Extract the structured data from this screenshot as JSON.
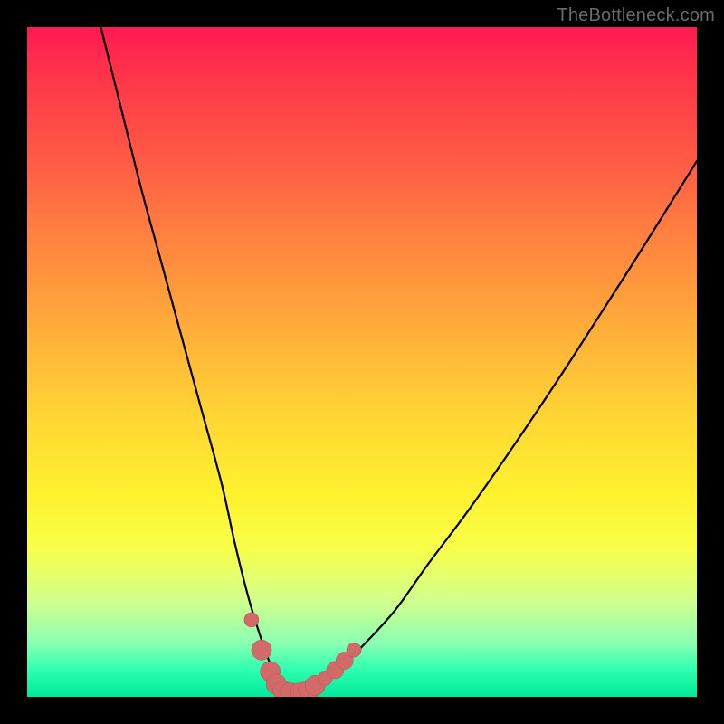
{
  "watermark": "TheBottleneck.com",
  "colors": {
    "background": "#000000",
    "curve_stroke": "#000000",
    "marker_fill": "#d36a6a",
    "marker_stroke": "#b94f4f"
  },
  "chart_data": {
    "type": "line",
    "title": "",
    "xlabel": "",
    "ylabel": "",
    "xlim": [
      0,
      100
    ],
    "ylim": [
      0,
      100
    ],
    "grid": false,
    "legend": false,
    "series": [
      {
        "name": "bottleneck-curve",
        "x": [
          11,
          14,
          17,
          20,
          23,
          26,
          29,
          31,
          33,
          35,
          36.5,
          38,
          40,
          42.5,
          46,
          50,
          55,
          60,
          66,
          73,
          81,
          90,
          100
        ],
        "y": [
          100,
          88,
          76,
          65,
          54,
          43,
          32,
          23,
          15,
          8.5,
          4.5,
          2,
          0.7,
          1.3,
          3.5,
          7.5,
          13,
          20,
          28,
          38,
          50,
          64,
          80
        ]
      }
    ],
    "markers": [
      {
        "x": 33.5,
        "y": 11.5,
        "r": 1.1
      },
      {
        "x": 35.0,
        "y": 7.0,
        "r": 1.5
      },
      {
        "x": 36.3,
        "y": 3.8,
        "r": 1.5
      },
      {
        "x": 37.2,
        "y": 1.9,
        "r": 1.5
      },
      {
        "x": 38.2,
        "y": 0.9,
        "r": 1.5
      },
      {
        "x": 39.3,
        "y": 0.6,
        "r": 1.5
      },
      {
        "x": 40.7,
        "y": 0.6,
        "r": 1.5
      },
      {
        "x": 42.0,
        "y": 1.0,
        "r": 1.5
      },
      {
        "x": 43.0,
        "y": 1.7,
        "r": 1.5
      },
      {
        "x": 44.5,
        "y": 2.8,
        "r": 1.1
      },
      {
        "x": 46.0,
        "y": 4.0,
        "r": 1.3
      },
      {
        "x": 47.4,
        "y": 5.4,
        "r": 1.3
      },
      {
        "x": 48.8,
        "y": 7.0,
        "r": 1.1
      }
    ],
    "gradient_stops": [
      {
        "pos": 0,
        "color": "#ff1a52"
      },
      {
        "pos": 8,
        "color": "#ff3749"
      },
      {
        "pos": 20,
        "color": "#ff5b45"
      },
      {
        "pos": 32,
        "color": "#ff843f"
      },
      {
        "pos": 45,
        "color": "#ffad3a"
      },
      {
        "pos": 58,
        "color": "#ffd534"
      },
      {
        "pos": 70,
        "color": "#fff22f"
      },
      {
        "pos": 78,
        "color": "#f7ff4a"
      },
      {
        "pos": 86,
        "color": "#cfff8f"
      },
      {
        "pos": 92,
        "color": "#8affb3"
      },
      {
        "pos": 96,
        "color": "#2dffb0"
      },
      {
        "pos": 100,
        "color": "#00e89a"
      }
    ]
  }
}
